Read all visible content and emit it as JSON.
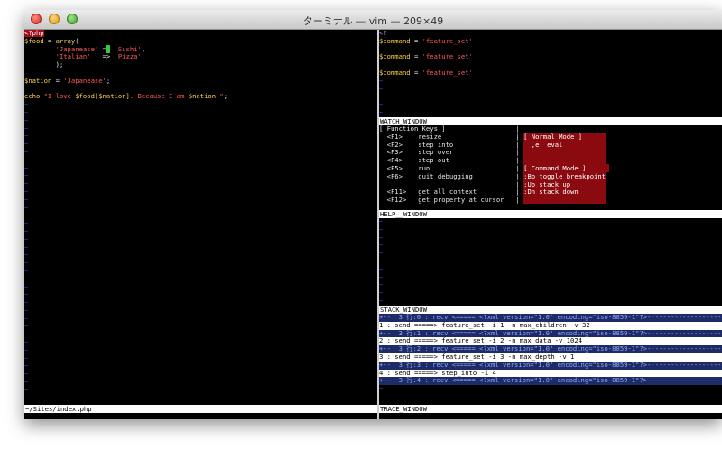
{
  "window": {
    "title": "ターミナル — vim — 209×49"
  },
  "left_pane": {
    "lines": [
      [
        {
          "t": "<?php",
          "c": "linebar"
        }
      ],
      [
        {
          "t": "$food",
          "c": "c-var"
        },
        {
          "t": " = ",
          "c": "c-plain"
        },
        {
          "t": "array",
          "c": "c-kw"
        },
        {
          "t": "(",
          "c": "c-plain"
        }
      ],
      [
        {
          "t": "        ",
          "c": "c-plain"
        },
        {
          "t": "'Japanease'",
          "c": "c-str"
        },
        {
          "t": " =",
          "c": "c-plain"
        },
        {
          "t": " ",
          "c": "cursor"
        },
        {
          "t": " ",
          "c": "c-plain"
        },
        {
          "t": "'Sushi'",
          "c": "c-str"
        },
        {
          "t": ",",
          "c": "c-plain"
        }
      ],
      [
        {
          "t": "        ",
          "c": "c-plain"
        },
        {
          "t": "'Italian'",
          "c": "c-str"
        },
        {
          "t": "   => ",
          "c": "c-plain"
        },
        {
          "t": "'Pizza'",
          "c": "c-str"
        }
      ],
      [
        {
          "t": "        );",
          "c": "c-plain"
        }
      ],
      [
        {
          "t": "",
          "c": "c-plain"
        }
      ],
      [
        {
          "t": "$nation",
          "c": "c-var"
        },
        {
          "t": " = ",
          "c": "c-plain"
        },
        {
          "t": "'Japanease'",
          "c": "c-str"
        },
        {
          "t": ";",
          "c": "c-plain"
        }
      ],
      [
        {
          "t": "",
          "c": "c-plain"
        }
      ],
      [
        {
          "t": "echo",
          "c": "c-kw"
        },
        {
          "t": " ",
          "c": "c-plain"
        },
        {
          "t": "\"I love ",
          "c": "c-str"
        },
        {
          "t": "$food[$nation]",
          "c": "c-var"
        },
        {
          "t": ". Because I am ",
          "c": "c-str"
        },
        {
          "t": "$nation",
          "c": "c-var"
        },
        {
          "t": ".\"",
          "c": "c-str"
        },
        {
          "t": ";",
          "c": "c-plain"
        }
      ]
    ],
    "tilde_count": 37,
    "status": "~/Sites/index.php"
  },
  "right_top": {
    "lines": [
      [
        {
          "t": "<?",
          "c": "c-purple"
        }
      ],
      [
        {
          "t": "$command",
          "c": "c-var"
        },
        {
          "t": " = ",
          "c": "c-plain"
        },
        {
          "t": "'feature_set'",
          "c": "c-str"
        }
      ],
      [
        {
          "t": "",
          "c": "c-plain"
        }
      ],
      [
        {
          "t": "$command",
          "c": "c-var"
        },
        {
          "t": " = ",
          "c": "c-plain"
        },
        {
          "t": "'feature_set'",
          "c": "c-str"
        }
      ],
      [
        {
          "t": "",
          "c": "c-plain"
        }
      ],
      [
        {
          "t": "$command",
          "c": "c-var"
        },
        {
          "t": " = ",
          "c": "c-plain"
        },
        {
          "t": "'feature_set'",
          "c": "c-str"
        }
      ]
    ],
    "tilde_count": 5,
    "status": "WATCH_WINDOW"
  },
  "watch": {
    "lines": [
      [
        {
          "t": "[ Function Keys ]                  ",
          "c": "c-plain"
        },
        {
          "t": "|",
          "c": "c-plain"
        }
      ],
      [
        {
          "t": "  <F1>    resize                   ",
          "c": "c-plain"
        },
        {
          "t": "| ",
          "c": "c-plain"
        },
        {
          "t": "[ Normal Mode ]      ",
          "c": "redblock"
        }
      ],
      [
        {
          "t": "  <F2>    step into                ",
          "c": "c-plain"
        },
        {
          "t": "| ",
          "c": "c-plain"
        },
        {
          "t": "  ,e  eval           ",
          "c": "redblock"
        }
      ],
      [
        {
          "t": "  <F3>    step over                ",
          "c": "c-plain"
        },
        {
          "t": "| ",
          "c": "c-plain"
        },
        {
          "t": "                     ",
          "c": "redblock"
        }
      ],
      [
        {
          "t": "  <F4>    step out                 ",
          "c": "c-plain"
        },
        {
          "t": "| ",
          "c": "c-plain"
        },
        {
          "t": "                     ",
          "c": "redblock"
        }
      ],
      [
        {
          "t": "  <F5>    run                      ",
          "c": "c-plain"
        },
        {
          "t": "| ",
          "c": "c-plain"
        },
        {
          "t": "[ Command Mode ]      ",
          "c": "redblock"
        }
      ],
      [
        {
          "t": "  <F6>    quit debugging           ",
          "c": "c-plain"
        },
        {
          "t": "| ",
          "c": "c-plain"
        },
        {
          "t": ":Bp toggle breakpoint",
          "c": "redblock"
        }
      ],
      [
        {
          "t": "                                   ",
          "c": "c-plain"
        },
        {
          "t": "| ",
          "c": "c-plain"
        },
        {
          "t": ":Up stack up         ",
          "c": "redblock"
        }
      ],
      [
        {
          "t": "  <F11>   get all context          ",
          "c": "c-plain"
        },
        {
          "t": "| ",
          "c": "c-plain"
        },
        {
          "t": ":Dn stack down       ",
          "c": "redblock"
        }
      ],
      [
        {
          "t": "  <F12>   get property at cursor   ",
          "c": "c-plain"
        },
        {
          "t": "| ",
          "c": "c-plain"
        },
        {
          "t": "                     ",
          "c": "redblock"
        }
      ]
    ],
    "status": "HELP__WINDOW"
  },
  "help": {
    "tilde_count": 11,
    "status": "STACK_WINDOW"
  },
  "stack": {
    "lines": [
      {
        "t": "+--  3 行:0 : recv <===== <?xml version=\"1.0\" encoding=\"iso-8859-1\"?>---------------------------------------------",
        "c": "stk-light"
      },
      {
        "t": "1 : send =====> feature_set -i 1 -n max_children -v 32",
        "c": "stk-dark"
      },
      {
        "t": "+--  3 行:1 : recv <===== <?xml version=\"1.0\" encoding=\"iso-8859-1\"?>---------------------------------------------",
        "c": "stk-light"
      },
      {
        "t": "2 : send =====> feature_set -i 2 -n max_data -v 1024",
        "c": "stk-dark"
      },
      {
        "t": "+--  3 行:2 : recv <===== <?xml version=\"1.0\" encoding=\"iso-8859-1\"?>---------------------------------------------",
        "c": "stk-light"
      },
      {
        "t": "3 : send =====> feature_set -i 3 -n max_depth -v 1",
        "c": "stk-dark"
      },
      {
        "t": "+--  3 行:3 : recv <===== <?xml version=\"1.0\" encoding=\"iso-8859-1\"?>---------------------------------------------",
        "c": "stk-light"
      },
      {
        "t": "4 : send =====> step_into -i 4",
        "c": "stk-dark"
      },
      {
        "t": "+--  3 行:4 : recv <===== <?xml version=\"1.0\" encoding=\"iso-8859-1\"?>---------------------------------------------",
        "c": "stk-light"
      }
    ],
    "tilde_count": 1,
    "status": "TRACE_WINDOW"
  }
}
